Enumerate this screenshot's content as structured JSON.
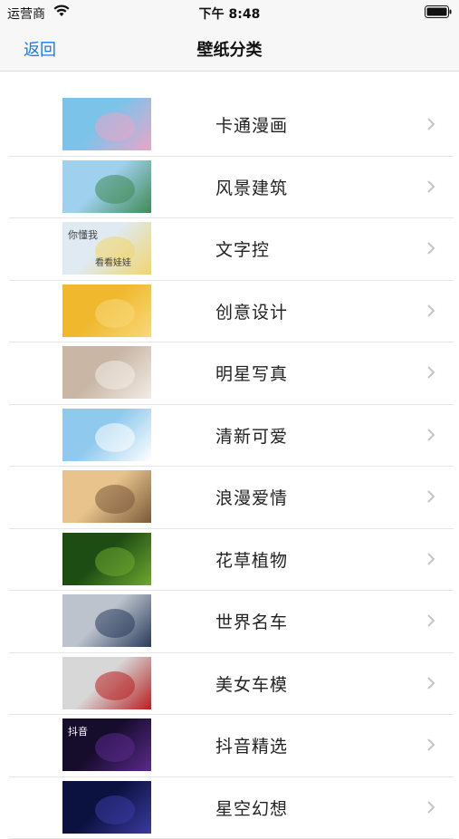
{
  "status": {
    "carrier": "运营商",
    "time": "下午 8:48"
  },
  "nav": {
    "back_label": "返回",
    "title": "壁纸分类"
  },
  "categories": [
    {
      "label": "卡通漫画",
      "thumb_icon": "anime-girl-thumbnail",
      "colors": [
        "#7cc3ea",
        "#e8a6c8"
      ]
    },
    {
      "label": "风景建筑",
      "thumb_icon": "landscape-pagoda-thumbnail",
      "colors": [
        "#9fd0ee",
        "#3f8a55"
      ]
    },
    {
      "label": "文字控",
      "thumb_icon": "text-cartoon-thumbnail",
      "colors": [
        "#dfeaf2",
        "#f2d56a"
      ],
      "thumb_text": "你懂我",
      "thumb_text2": "看看娃娃"
    },
    {
      "label": "创意设计",
      "thumb_icon": "lemon-faces-thumbnail",
      "colors": [
        "#f0b82c",
        "#f8d87a"
      ]
    },
    {
      "label": "明星写真",
      "thumb_icon": "portrait-thumbnail",
      "colors": [
        "#c9b6a4",
        "#f2ece6"
      ]
    },
    {
      "label": "清新可爱",
      "thumb_icon": "cute-bunny-thumbnail",
      "colors": [
        "#8fc9ee",
        "#ffffff"
      ]
    },
    {
      "label": "浪漫爱情",
      "thumb_icon": "couple-field-thumbnail",
      "colors": [
        "#e8c48c",
        "#7b5a3a"
      ]
    },
    {
      "label": "花草植物",
      "thumb_icon": "daisy-thumbnail",
      "colors": [
        "#1e4d14",
        "#6ea82f"
      ]
    },
    {
      "label": "世界名车",
      "thumb_icon": "sports-car-thumbnail",
      "colors": [
        "#bcc3cd",
        "#2a3b5c"
      ]
    },
    {
      "label": "美女车模",
      "thumb_icon": "car-model-thumbnail",
      "colors": [
        "#d7d7d7",
        "#b82020"
      ]
    },
    {
      "label": "抖音精选",
      "thumb_icon": "tiktok-thumbnail",
      "colors": [
        "#160c2c",
        "#5a2a8c"
      ],
      "thumb_text": "抖音"
    },
    {
      "label": "星空幻想",
      "thumb_icon": "galaxy-thumbnail",
      "colors": [
        "#0b1240",
        "#3b3aa0"
      ]
    }
  ]
}
